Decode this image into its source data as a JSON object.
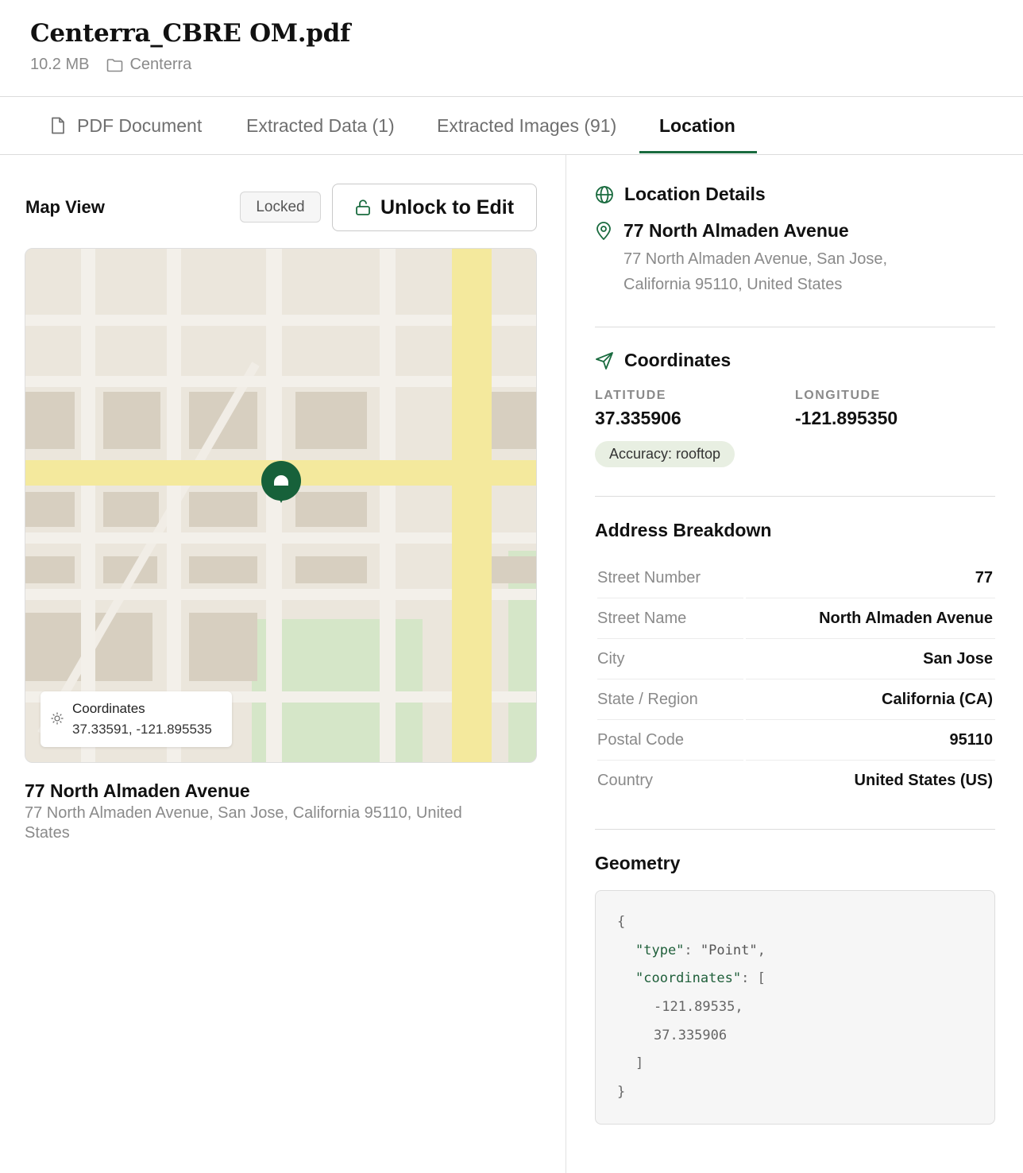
{
  "file": {
    "title": "Centerra_CBRE OM.pdf",
    "size": "10.2 MB",
    "folder": "Centerra"
  },
  "tabs": [
    {
      "label": "PDF Document",
      "icon": "document-icon"
    },
    {
      "label": "Extracted Data (1)"
    },
    {
      "label": "Extracted Images (91)"
    },
    {
      "label": "Location",
      "active": true
    }
  ],
  "map_panel": {
    "title": "Map View",
    "locked_label": "Locked",
    "unlock_label": "Unlock to Edit",
    "coords_label": "Coordinates",
    "coords_value": "37.33591, -121.895535",
    "address_title": "77 North Almaden Avenue",
    "address_full": "77 North Almaden Avenue, San Jose, California 95110, United States"
  },
  "details": {
    "title": "Location Details",
    "name": "77 North Almaden Avenue",
    "address_line1": "77 North Almaden Avenue, San Jose,",
    "address_line2": "California 95110, United States"
  },
  "coordinates": {
    "title": "Coordinates",
    "latitude_label": "LATITUDE",
    "latitude": "37.335906",
    "longitude_label": "LONGITUDE",
    "longitude": "-121.895350",
    "accuracy": "Accuracy: rooftop"
  },
  "address_breakdown": {
    "title": "Address Breakdown",
    "rows": [
      {
        "label": "Street Number",
        "value": "77"
      },
      {
        "label": "Street Name",
        "value": "North Almaden Avenue"
      },
      {
        "label": "City",
        "value": "San Jose"
      },
      {
        "label": "State / Region",
        "value": "California (CA)"
      },
      {
        "label": "Postal Code",
        "value": "95110"
      },
      {
        "label": "Country",
        "value": "United States (US)"
      }
    ]
  },
  "geometry": {
    "title": "Geometry",
    "open_brace": "{",
    "type_key": "\"type\"",
    "type_value": "\"Point\"",
    "coords_key": "\"coordinates\"",
    "open_bracket": "[",
    "lon": "-121.89535,",
    "lat": "37.335906",
    "close_bracket": "]",
    "close_brace": "}"
  },
  "colors": {
    "accent": "#1a6b3f",
    "pin": "#17613a",
    "map_land": "#ebe6dc",
    "map_block": "#d7cfc0",
    "map_road": "#f3f0ea",
    "map_major_road": "#f4e99d",
    "map_park": "#d5e6c8"
  }
}
